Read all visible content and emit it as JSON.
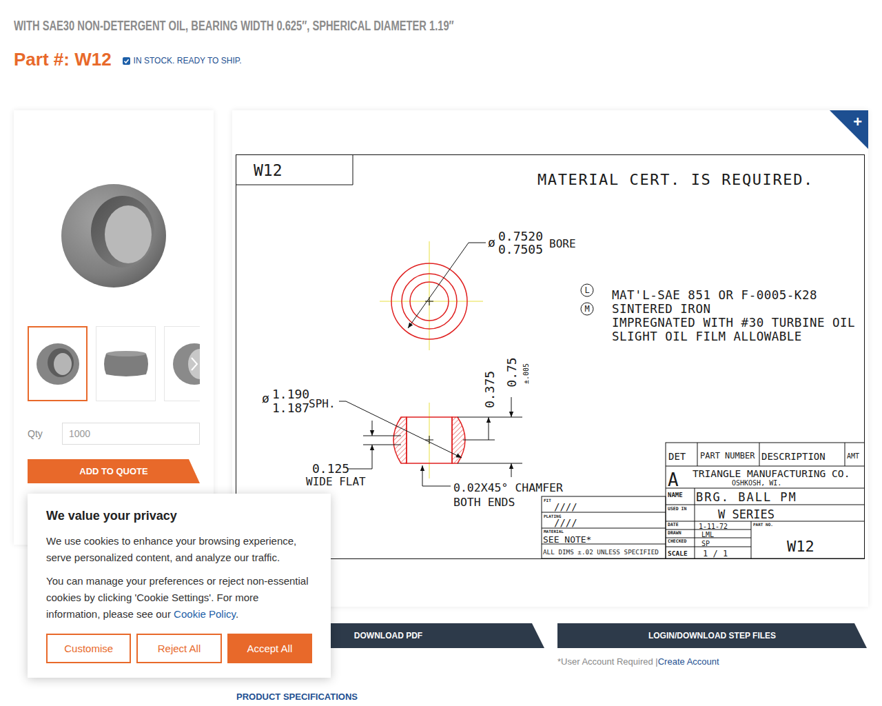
{
  "page": {
    "subtitle": "WITH SAE30 NON-DETERGENT OIL, BEARING WIDTH 0.625″, SPHERICAL DIAMETER 1.19″",
    "part_label": "Part #: W12",
    "stock": "IN STOCK. READY TO SHIP.",
    "stock_checked": true
  },
  "gallery": {
    "thumbnails": [
      {
        "kind": "front",
        "selected": true
      },
      {
        "kind": "side",
        "selected": false
      },
      {
        "kind": "angle",
        "selected": false
      }
    ]
  },
  "quote": {
    "qty_label": "Qty",
    "qty_placeholder": "1000",
    "button": "ADD TO QUOTE"
  },
  "expand": "+",
  "drawing": {
    "corner_label": "W12",
    "note": "MATERIAL CERT. IS REQUIRED.",
    "diameter_symbol": "ø",
    "bore": {
      "max": "0.7520",
      "min": "0.7505",
      "label": "BORE"
    },
    "material_markers": [
      "L",
      "M"
    ],
    "material_lines": [
      "MAT'L-SAE 851 OR F-0005-K28",
      "SINTERED IRON",
      "IMPREGNATED WITH #30 TURBINE OIL",
      "SLIGHT OIL FILM ALLOWABLE"
    ],
    "sphere": {
      "max": "1.190",
      "min": "1.187",
      "label": "SPH."
    },
    "half_width": "0.375",
    "width": {
      "value": "0.75",
      "tolerance": "±.005"
    },
    "flat": {
      "value": "0.125",
      "label": "WIDE FLAT"
    },
    "chamfer": {
      "value": "0.02X45° CHAMFER",
      "label": "BOTH ENDS"
    },
    "title_block": {
      "headers": [
        "DET",
        "PART NUMBER",
        "DESCRIPTION",
        "AMT"
      ],
      "rev": "A",
      "company": "TRIANGLE MANUFACTURING CO.",
      "city": "OSHKOSH, WI.",
      "fields": [
        {
          "label": "NAME",
          "value": "BRG. BALL PM"
        },
        {
          "label": "USED IN",
          "value": "W SERIES"
        },
        {
          "label": "DATE",
          "value": "1-11-72"
        },
        {
          "label": "DRAWN",
          "value": "LML"
        },
        {
          "label": "CHECKED",
          "value": "SP"
        },
        {
          "label": "SCALE",
          "value": "1 / 1"
        }
      ],
      "part_no_label": "PART NO.",
      "part_no": "W12"
    },
    "notes_block": [
      {
        "label": "FIT",
        "value": "////"
      },
      {
        "label": "PLATING",
        "value": "////"
      },
      {
        "label": "MATERIAL",
        "value": "SEE NOTE*"
      }
    ],
    "tolerance_note": "ALL DIMS ±.02 UNLESS SPECIFIED"
  },
  "downloads": {
    "pdf": "DOWNLOAD PDF",
    "step": "LOGIN/DOWNLOAD STEP FILES",
    "note": "*User Account Required",
    "separator": "|",
    "link": "Create Account"
  },
  "section_tab": "PRODUCT SPECIFICATIONS",
  "cookie": {
    "title": "We value your privacy",
    "text": "We use cookies to enhance your browsing experience, serve personalized content, and analyze our traffic.",
    "manage": "You can manage your preferences or reject non-essential cookies by clicking 'Cookie Settings'. For more information, please see our ",
    "link": "Cookie Policy",
    "after": ".",
    "buttons": [
      {
        "label": "Customise",
        "kind": "outline"
      },
      {
        "label": "Reject All",
        "kind": "outline"
      },
      {
        "label": "Accept All",
        "kind": "filled"
      }
    ]
  }
}
